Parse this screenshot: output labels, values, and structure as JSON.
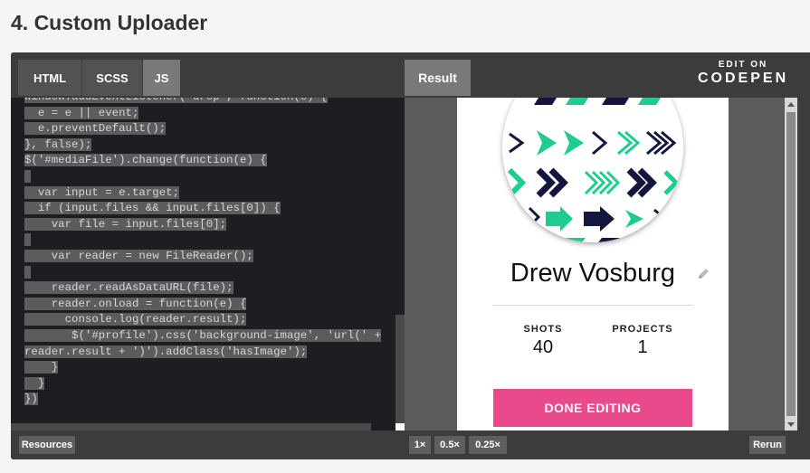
{
  "page": {
    "heading": "4. Custom Uploader"
  },
  "editor_tabs": [
    {
      "label": "HTML"
    },
    {
      "label": "SCSS"
    },
    {
      "label": "JS"
    }
  ],
  "result_tab": {
    "label": "Result"
  },
  "codepen": {
    "edit_on": "EDIT ON",
    "brand": "CODEPEN"
  },
  "code_lines": [
    "window.addEventListener('drop', function(e) {",
    "  e = e || event;",
    "  e.preventDefault();",
    "}, false);",
    "$('#mediaFile').change(function(e) {",
    "",
    "  var input = e.target;",
    "  if (input.files && input.files[0]) {",
    "    var file = input.files[0];",
    "",
    "    var reader = new FileReader();",
    "",
    "    reader.readAsDataURL(file);",
    "    reader.onload = function(e) {",
    "      console.log(reader.result);",
    "       $('#profile').css('background-image', 'url(' +",
    "reader.result + ')').addClass('hasImage');",
    "    }",
    "  }",
    "})"
  ],
  "profile": {
    "name": "Drew Vosburg",
    "stats": [
      {
        "label": "SHOTS",
        "value": "40"
      },
      {
        "label": "PROJECTS",
        "value": "1"
      }
    ],
    "done_button": "DONE EDITING"
  },
  "bottom": {
    "resources": "Resources",
    "zoom": [
      "1×",
      "0.5×",
      "0.25×"
    ],
    "rerun": "Rerun"
  },
  "colors": {
    "accent_pink": "#e84a8b",
    "navy": "#14163f",
    "green": "#1fcc8f"
  }
}
